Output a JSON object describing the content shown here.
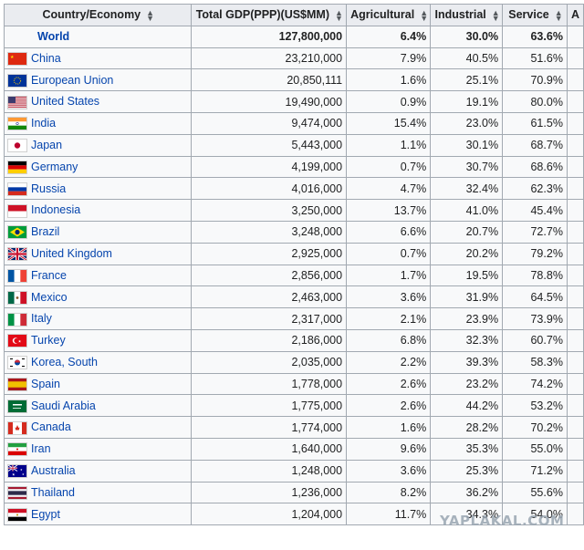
{
  "columns": [
    "Country/Economy",
    "Total GDP(PPP)(US$MM)",
    "Agricultural",
    "Industrial",
    "Service",
    "A"
  ],
  "rows": [
    {
      "country": "World",
      "gdp": "127,800,000",
      "agri": "6.4%",
      "ind": "30.0%",
      "serv": "63.6%",
      "flag": "none",
      "bold": true
    },
    {
      "country": "China",
      "gdp": "23,210,000",
      "agri": "7.9%",
      "ind": "40.5%",
      "serv": "51.6%",
      "flag": "china-flag-icon"
    },
    {
      "country": "European Union",
      "gdp": "20,850,111",
      "agri": "1.6%",
      "ind": "25.1%",
      "serv": "70.9%",
      "flag": "eu-flag-icon"
    },
    {
      "country": "United States",
      "gdp": "19,490,000",
      "agri": "0.9%",
      "ind": "19.1%",
      "serv": "80.0%",
      "flag": "usa-flag-icon"
    },
    {
      "country": "India",
      "gdp": "9,474,000",
      "agri": "15.4%",
      "ind": "23.0%",
      "serv": "61.5%",
      "flag": "india-flag-icon"
    },
    {
      "country": "Japan",
      "gdp": "5,443,000",
      "agri": "1.1%",
      "ind": "30.1%",
      "serv": "68.7%",
      "flag": "japan-flag-icon"
    },
    {
      "country": "Germany",
      "gdp": "4,199,000",
      "agri": "0.7%",
      "ind": "30.7%",
      "serv": "68.6%",
      "flag": "germany-flag-icon"
    },
    {
      "country": "Russia",
      "gdp": "4,016,000",
      "agri": "4.7%",
      "ind": "32.4%",
      "serv": "62.3%",
      "flag": "russia-flag-icon"
    },
    {
      "country": "Indonesia",
      "gdp": "3,250,000",
      "agri": "13.7%",
      "ind": "41.0%",
      "serv": "45.4%",
      "flag": "indonesia-flag-icon"
    },
    {
      "country": "Brazil",
      "gdp": "3,248,000",
      "agri": "6.6%",
      "ind": "20.7%",
      "serv": "72.7%",
      "flag": "brazil-flag-icon"
    },
    {
      "country": "United Kingdom",
      "gdp": "2,925,000",
      "agri": "0.7%",
      "ind": "20.2%",
      "serv": "79.2%",
      "flag": "uk-flag-icon"
    },
    {
      "country": "France",
      "gdp": "2,856,000",
      "agri": "1.7%",
      "ind": "19.5%",
      "serv": "78.8%",
      "flag": "france-flag-icon"
    },
    {
      "country": "Mexico",
      "gdp": "2,463,000",
      "agri": "3.6%",
      "ind": "31.9%",
      "serv": "64.5%",
      "flag": "mexico-flag-icon"
    },
    {
      "country": "Italy",
      "gdp": "2,317,000",
      "agri": "2.1%",
      "ind": "23.9%",
      "serv": "73.9%",
      "flag": "italy-flag-icon"
    },
    {
      "country": "Turkey",
      "gdp": "2,186,000",
      "agri": "6.8%",
      "ind": "32.3%",
      "serv": "60.7%",
      "flag": "turkey-flag-icon"
    },
    {
      "country": "Korea, South",
      "gdp": "2,035,000",
      "agri": "2.2%",
      "ind": "39.3%",
      "serv": "58.3%",
      "flag": "south-korea-flag-icon"
    },
    {
      "country": "Spain",
      "gdp": "1,778,000",
      "agri": "2.6%",
      "ind": "23.2%",
      "serv": "74.2%",
      "flag": "spain-flag-icon"
    },
    {
      "country": "Saudi Arabia",
      "gdp": "1,775,000",
      "agri": "2.6%",
      "ind": "44.2%",
      "serv": "53.2%",
      "flag": "saudi-arabia-flag-icon"
    },
    {
      "country": "Canada",
      "gdp": "1,774,000",
      "agri": "1.6%",
      "ind": "28.2%",
      "serv": "70.2%",
      "flag": "canada-flag-icon"
    },
    {
      "country": "Iran",
      "gdp": "1,640,000",
      "agri": "9.6%",
      "ind": "35.3%",
      "serv": "55.0%",
      "flag": "iran-flag-icon"
    },
    {
      "country": "Australia",
      "gdp": "1,248,000",
      "agri": "3.6%",
      "ind": "25.3%",
      "serv": "71.2%",
      "flag": "australia-flag-icon"
    },
    {
      "country": "Thailand",
      "gdp": "1,236,000",
      "agri": "8.2%",
      "ind": "36.2%",
      "serv": "55.6%",
      "flag": "thailand-flag-icon"
    },
    {
      "country": "Egypt",
      "gdp": "1,204,000",
      "agri": "11.7%",
      "ind": "34.3%",
      "serv": "54.0%",
      "flag": "egypt-flag-icon"
    }
  ],
  "sort_icon": "sort-arrows-icon",
  "watermark": "YAPLAKAL.COM",
  "colors": {
    "link": "#0645ad",
    "header_bg": "#eaecf0",
    "cell_bg": "#f8f9fa",
    "border": "#a2a9b1"
  }
}
